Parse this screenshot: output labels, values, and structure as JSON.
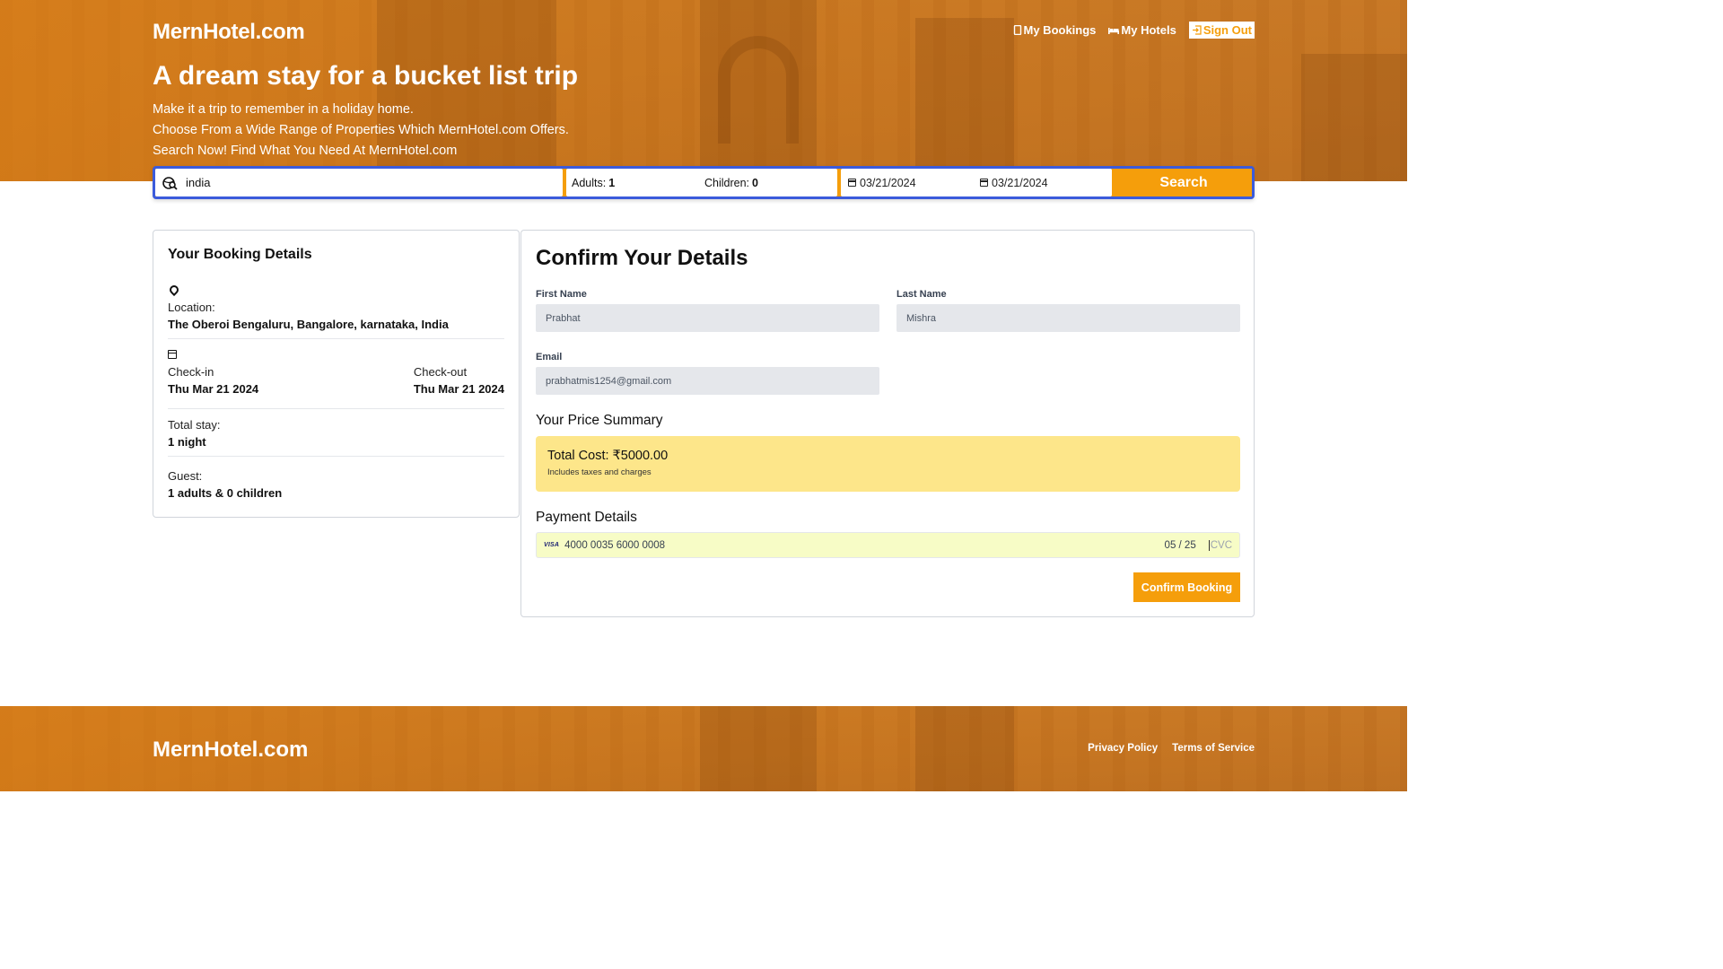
{
  "header": {
    "logo": "MernHotel.com",
    "nav": {
      "my_bookings": "My Bookings",
      "my_hotels": "My Hotels",
      "sign_out": "Sign Out"
    },
    "hero_title": "A dream stay for a bucket list trip",
    "hero_lines": [
      "Make it a trip to remember in a holiday home.",
      "Choose From a Wide Range of Properties Which MernHotel.com Offers.",
      "Search Now! Find What You Need At MernHotel.com"
    ]
  },
  "search": {
    "destination": "india",
    "adults_label": "Adults:",
    "adults_value": "1",
    "children_label": "Children:",
    "children_value": "0",
    "check_in": "03/21/2024",
    "check_out": "03/21/2024",
    "button": "Search"
  },
  "booking_details": {
    "title": "Your Booking Details",
    "location_label": "Location:",
    "location_value": "The Oberoi Bengaluru, Bangalore, karnataka, India",
    "checkin_label": "Check-in",
    "checkin_value": "Thu Mar 21 2024",
    "checkout_label": "Check-out",
    "checkout_value": "Thu Mar 21 2024",
    "total_stay_label": "Total stay:",
    "total_stay_value": "1 night",
    "guest_label": "Guest:",
    "guest_value": "1 adults & 0 children"
  },
  "confirm": {
    "title": "Confirm Your Details",
    "first_name_label": "First Name",
    "first_name_value": "Prabhat",
    "last_name_label": "Last Name",
    "last_name_value": "Mishra",
    "email_label": "Email",
    "email_value": "prabhatmis1254@gmail.com",
    "price_summary_title": "Your Price Summary",
    "total_cost": "Total Cost: ₹5000.00",
    "includes": "Includes taxes and charges",
    "payment_title": "Payment Details",
    "card_brand": "VISA",
    "card_number": "4000 0035 6000 0008",
    "card_expiry": "05 / 25",
    "cvc_placeholder": "CVC",
    "confirm_button": "Confirm Booking"
  },
  "footer": {
    "logo": "MernHotel.com",
    "privacy": "Privacy Policy",
    "terms": "Terms of Service"
  },
  "colors": {
    "accent": "#f59e0b",
    "search_border": "#3b5bdb",
    "price_box": "#fde68a",
    "card_input": "#f7fcc6"
  }
}
